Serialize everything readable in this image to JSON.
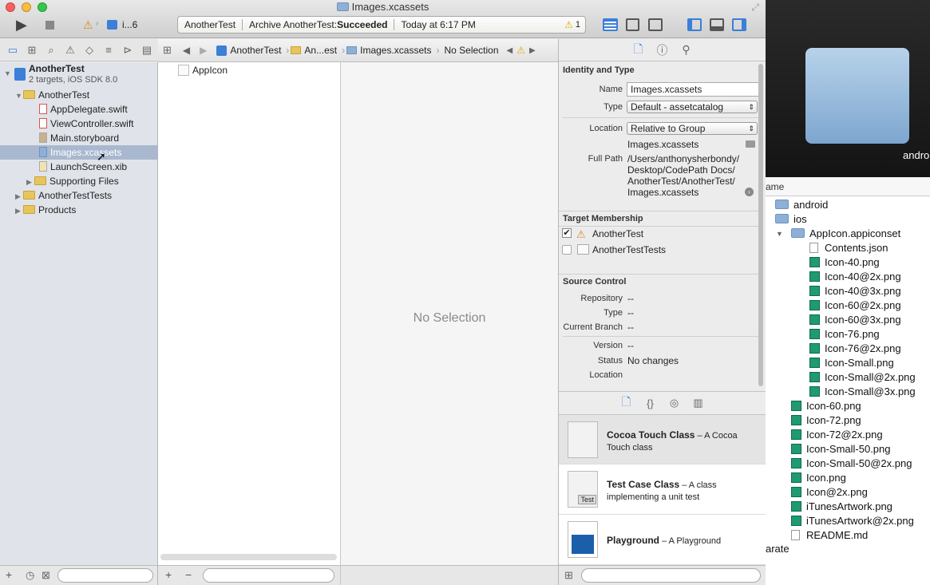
{
  "window": {
    "title": "Images.xcassets",
    "scheme": "i...6",
    "activity": {
      "project": "AnotherTest",
      "status_prefix": "Archive AnotherTest: ",
      "status": "Succeeded",
      "time": "Today at 6:17 PM",
      "warnings": "1"
    }
  },
  "navigator": {
    "project": {
      "name": "AnotherTest",
      "subtitle": "2 targets, iOS SDK 8.0"
    },
    "items": [
      {
        "label": "AnotherTest"
      },
      {
        "label": "AppDelegate.swift"
      },
      {
        "label": "ViewController.swift"
      },
      {
        "label": "Main.storyboard"
      },
      {
        "label": "Images.xcassets"
      },
      {
        "label": "LaunchScreen.xib"
      },
      {
        "label": "Supporting Files"
      },
      {
        "label": "AnotherTestTests"
      },
      {
        "label": "Products"
      }
    ]
  },
  "jumpbar": {
    "crumbs": [
      "AnotherTest",
      "An...est",
      "Images.xcassets",
      "No Selection"
    ]
  },
  "asset_list": {
    "items": [
      {
        "label": "AppIcon"
      }
    ]
  },
  "editor": {
    "empty_text": "No Selection"
  },
  "inspector": {
    "identity": {
      "header": "Identity and Type",
      "name_label": "Name",
      "name_value": "Images.xcassets",
      "type_label": "Type",
      "type_value": "Default - assetcatalog",
      "location_label": "Location",
      "location_value": "Relative to Group",
      "location_file": "Images.xcassets",
      "full_path_label": "Full Path",
      "full_path_lines": [
        "/Users/anthonysherbondy/",
        "Desktop/CodePath Docs/",
        "AnotherTest/AnotherTest/",
        "Images.xcassets"
      ]
    },
    "membership": {
      "header": "Target Membership",
      "targets": [
        {
          "name": "AnotherTest",
          "checked": true
        },
        {
          "name": "AnotherTestTests",
          "checked": false
        }
      ]
    },
    "source_control": {
      "header": "Source Control",
      "repository_label": "Repository",
      "repository_value": "--",
      "type_label": "Type",
      "type_value": "--",
      "branch_label": "Current Branch",
      "branch_value": "--",
      "version_label": "Version",
      "version_value": "--",
      "status_label": "Status",
      "status_value": "No changes",
      "location_label": "Location"
    },
    "library": [
      {
        "title": "Cocoa Touch Class",
        "desc": " – A Cocoa Touch class"
      },
      {
        "title": "Test Case Class",
        "desc": " – A class implementing a unit test",
        "badge": "Test"
      },
      {
        "title": "Playground",
        "desc": " – A Playground"
      }
    ]
  },
  "finder": {
    "header_label": "andro",
    "column_label": "ame",
    "footer_text": "arate",
    "items": [
      {
        "label": "android",
        "kind": "folder",
        "depth": 0
      },
      {
        "label": "ios",
        "kind": "folder",
        "depth": 0
      },
      {
        "label": "AppIcon.appiconset",
        "kind": "folder",
        "depth": 1
      },
      {
        "label": "Contents.json",
        "kind": "file",
        "depth": 2
      },
      {
        "label": "Icon-40.png",
        "kind": "png",
        "depth": 2
      },
      {
        "label": "Icon-40@2x.png",
        "kind": "png",
        "depth": 2
      },
      {
        "label": "Icon-40@3x.png",
        "kind": "png",
        "depth": 2
      },
      {
        "label": "Icon-60@2x.png",
        "kind": "png",
        "depth": 2
      },
      {
        "label": "Icon-60@3x.png",
        "kind": "png",
        "depth": 2
      },
      {
        "label": "Icon-76.png",
        "kind": "png",
        "depth": 2
      },
      {
        "label": "Icon-76@2x.png",
        "kind": "png",
        "depth": 2
      },
      {
        "label": "Icon-Small.png",
        "kind": "png",
        "depth": 2
      },
      {
        "label": "Icon-Small@2x.png",
        "kind": "png",
        "depth": 2
      },
      {
        "label": "Icon-Small@3x.png",
        "kind": "png",
        "depth": 2
      },
      {
        "label": "Icon-60.png",
        "kind": "png",
        "depth": 1
      },
      {
        "label": "Icon-72.png",
        "kind": "png",
        "depth": 1
      },
      {
        "label": "Icon-72@2x.png",
        "kind": "png",
        "depth": 1
      },
      {
        "label": "Icon-Small-50.png",
        "kind": "png",
        "depth": 1
      },
      {
        "label": "Icon-Small-50@2x.png",
        "kind": "png",
        "depth": 1
      },
      {
        "label": "Icon.png",
        "kind": "png",
        "depth": 1
      },
      {
        "label": "Icon@2x.png",
        "kind": "png",
        "depth": 1
      },
      {
        "label": "iTunesArtwork.png",
        "kind": "png",
        "depth": 1
      },
      {
        "label": "iTunesArtwork@2x.png",
        "kind": "png",
        "depth": 1
      },
      {
        "label": "README.md",
        "kind": "file",
        "depth": 1
      }
    ]
  },
  "colors": {
    "accent": "#3b7fd8",
    "selection": "#a9b8cf",
    "warning": "#f2c200",
    "png_icon": "#1f9a72"
  }
}
